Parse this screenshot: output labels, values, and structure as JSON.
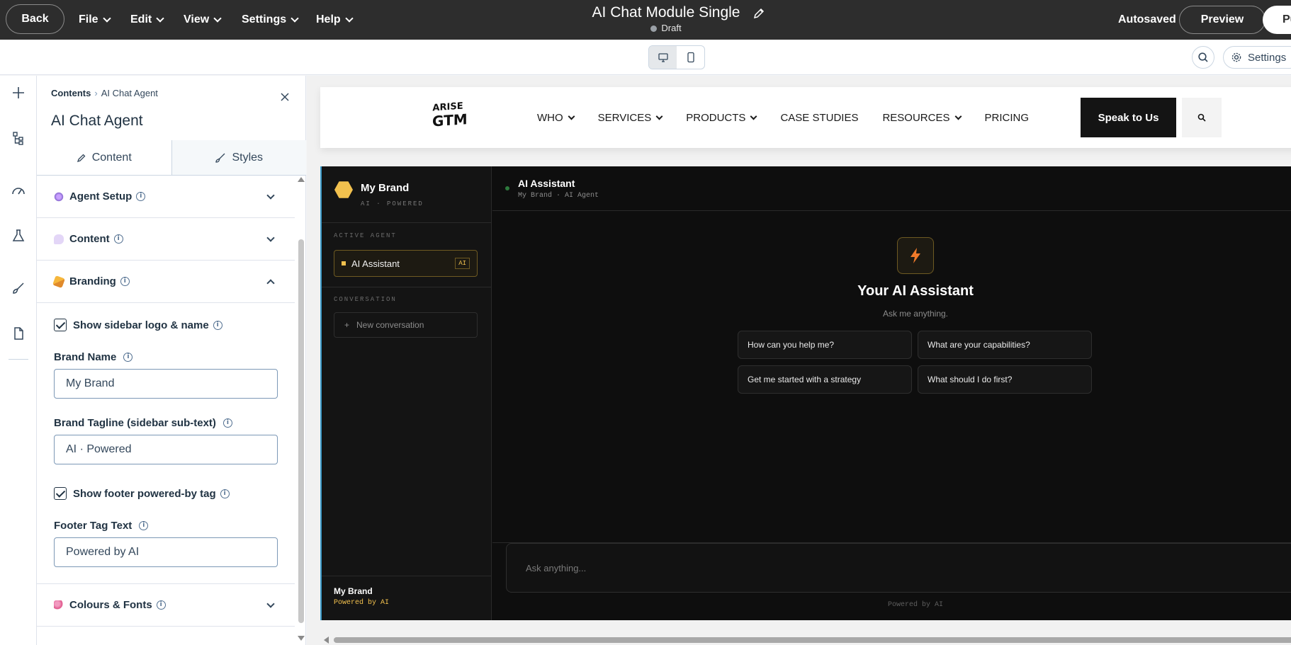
{
  "topbar": {
    "back": "Back",
    "menus": [
      "File",
      "Edit",
      "View",
      "Settings",
      "Help"
    ],
    "title": "AI Chat Module Single",
    "status": "Draft",
    "autosaved": "Autosaved",
    "preview": "Preview",
    "publish": "Pu"
  },
  "toolbar": {
    "settings": "Settings"
  },
  "panel": {
    "breadcrumb_root": "Contents",
    "breadcrumb_current": "AI Chat Agent",
    "title": "AI Chat Agent",
    "tabs": {
      "content": "Content",
      "styles": "Styles"
    },
    "sections": {
      "agent_setup": "Agent Setup",
      "content": "Content",
      "branding": "Branding",
      "colours_fonts": "Colours & Fonts"
    },
    "branding": {
      "show_sidebar_logo": "Show sidebar logo & name",
      "brand_name_label": "Brand Name",
      "brand_name_value": "My Brand",
      "tagline_label": "Brand Tagline (sidebar sub-text)",
      "tagline_value": "AI · Powered",
      "show_footer_tag": "Show footer powered-by tag",
      "footer_label": "Footer Tag Text",
      "footer_value": "Powered by AI"
    }
  },
  "site": {
    "logo_line1": "ARISE",
    "logo_line2": "GTM",
    "nav": [
      "WHO",
      "SERVICES",
      "PRODUCTS",
      "CASE STUDIES",
      "RESOURCES",
      "PRICING"
    ],
    "cta": "Speak to Us"
  },
  "chat": {
    "brand": "My Brand",
    "tagline": "AI · POWERED",
    "active_agent_caption": "ACTIVE AGENT",
    "agent_name": "AI Assistant",
    "agent_badge": "AI",
    "conversation_caption": "CONVERSATION",
    "new_conversation": "New conversation",
    "footer_brand": "My Brand",
    "footer_tag": "Powered by AI",
    "header_title": "AI Assistant",
    "header_sub": "My Brand · AI Agent",
    "hero_title": "Your AI Assistant",
    "hero_sub": "Ask me anything.",
    "suggestions": [
      "How can you help me?",
      "What are your capabilities?",
      "Get me started with a strategy",
      "What should I do first?"
    ],
    "input_placeholder": "Ask anything...",
    "powered": "Powered by AI"
  }
}
